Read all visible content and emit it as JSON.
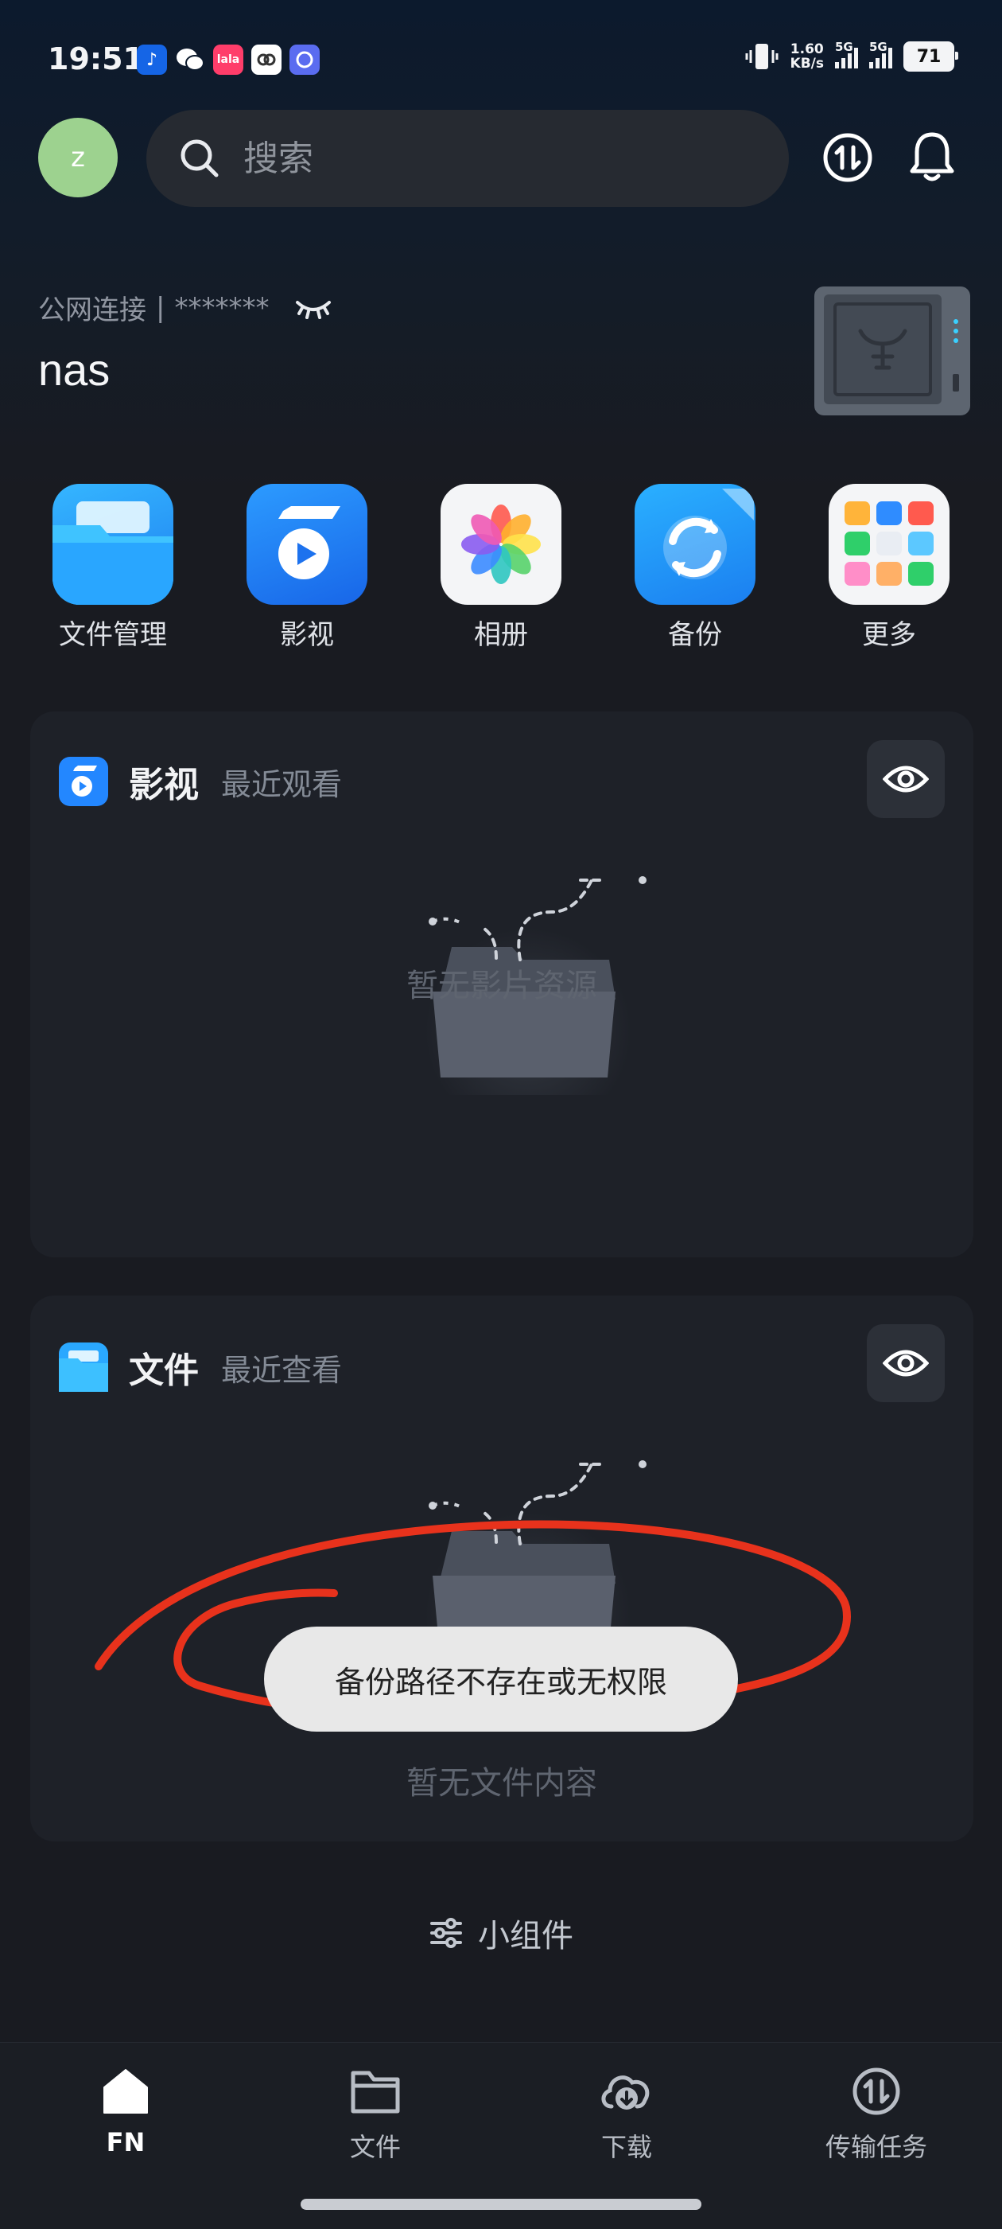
{
  "status_bar": {
    "time": "19:51",
    "net_speed_value": "1.60",
    "net_speed_unit": "KB/s",
    "signal1": "5G",
    "signal2": "5G",
    "battery": "71",
    "notif_icons": [
      "music-app-icon",
      "wechat-icon",
      "lala-app-icon",
      "link-app-icon",
      "browser-app-icon"
    ]
  },
  "header": {
    "avatar_letter": "z",
    "search_placeholder": "搜索"
  },
  "nas": {
    "connection": "公网连接",
    "separator": "|",
    "masked": "*******",
    "name": "nas"
  },
  "apps": [
    {
      "label": "文件管理",
      "icon": "file-manager-icon"
    },
    {
      "label": "影视",
      "icon": "video-icon"
    },
    {
      "label": "相册",
      "icon": "photos-icon"
    },
    {
      "label": "备份",
      "icon": "backup-icon"
    },
    {
      "label": "更多",
      "icon": "more-apps-icon"
    }
  ],
  "video_card": {
    "title": "影视",
    "subtitle": "最近观看",
    "empty_text": "暂无影片资源"
  },
  "file_card": {
    "title": "文件",
    "subtitle": "最近查看",
    "empty_text": "暂无文件内容"
  },
  "toast": {
    "message": "备份路径不存在或无权限"
  },
  "widgets_label": "小组件",
  "bottom_nav": [
    {
      "label": "FN",
      "icon": "home-icon",
      "active": true
    },
    {
      "label": "文件",
      "icon": "folder-icon",
      "active": false
    },
    {
      "label": "下载",
      "icon": "download-icon",
      "active": false
    },
    {
      "label": "传输任务",
      "icon": "transfer-icon",
      "active": false
    }
  ],
  "colors": {
    "background": "#191b21",
    "card": "#1e2128",
    "accent_blue": "#2f8cff",
    "annotation_red": "#e8321c",
    "toast_bg": "#e8e8e8"
  }
}
